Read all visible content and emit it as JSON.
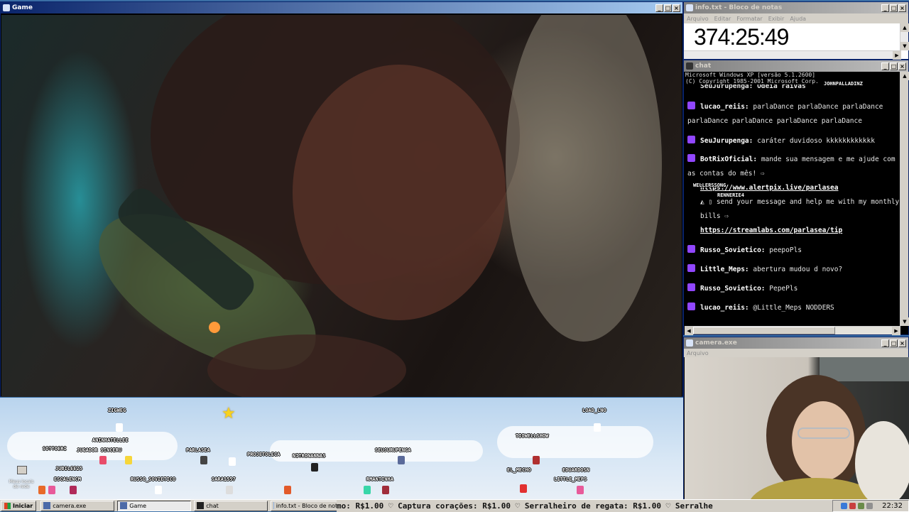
{
  "game_window": {
    "title": "Game"
  },
  "overlay": {
    "nicknames": [
      "ZIGWEG",
      "ANINHATELLEE",
      "SOTTOERI",
      "JUGADOR SINCERU",
      "JUBILEE25",
      "ESCALENCM",
      "RUSSO_SOVIETICO",
      "PARLASEA",
      "SARA1557",
      "PROJETOLECA",
      "NITRONANNAS",
      "SEUJURUPENGA",
      "RMANTINHA",
      "LOAD_LNO",
      "TIOWELLSHOW",
      "EL_MECHO",
      "EDUARDOSN",
      "LITTLE_MEPS"
    ],
    "desktop_icon_label": "Meus locais de rede"
  },
  "notepad": {
    "title": "info.txt - Bloco de notas",
    "menu": [
      "Arquivo",
      "Editar",
      "Formatar",
      "Exibir",
      "Ajuda"
    ],
    "text": "374:25:49"
  },
  "chat": {
    "title": "chat",
    "system_lines": [
      "Microsoft Windows XP [versão 5.1.2600]",
      "(C) Copyright 1985-2001 Microsoft Corp."
    ],
    "floating_nicks": [
      "JOHNPALLADINZ",
      "WELLERSSONG",
      "RENNERIE4"
    ],
    "cut_line": "SeuJurupenga: Odeia raivas",
    "messages": [
      {
        "user": "lucao_reiis:",
        "text": "parlaDance parlaDance parlaDance parlaDance parlaDance parlaDance parlaDance"
      },
      {
        "user": "SeuJurupenga:",
        "text": "caráter duvidoso kkkkkkkkkkkk"
      },
      {
        "user": "BotRixOficial:",
        "text": "mande sua mensagem e me ajude com as contas do mês! ⇨",
        "link1": "https://www.alertpix.live/parlasea",
        "text2": "◭ ▯ send your message and help me with my monthly bills ⇨",
        "link2": "https://streamlabs.com/parlasea/tip"
      },
      {
        "user": "Russo_Sovietico:",
        "text": "peepoPls"
      },
      {
        "user": "Little_Meps:",
        "text": "abertura mudou d novo?"
      },
      {
        "user": "Russo_Sovietico:",
        "text": "PepePls"
      },
      {
        "user": "lucao_reiis:",
        "text": "@Little_Meps NODDERS"
      }
    ]
  },
  "camera": {
    "title": "camera.exe",
    "menu": "Arquivo"
  },
  "taskbar": {
    "start": "Iniciar",
    "tasks": [
      "camera.exe",
      "Game",
      "chat",
      "info.txt - Bloco de notas"
    ],
    "active_task": "Game",
    "ticker": "mo: R$1.00 ♡ Captura corações: R$1.00 ♡ Serralheiro de regata: R$1.00 ♡ Serralhe",
    "clock": "22:32"
  }
}
